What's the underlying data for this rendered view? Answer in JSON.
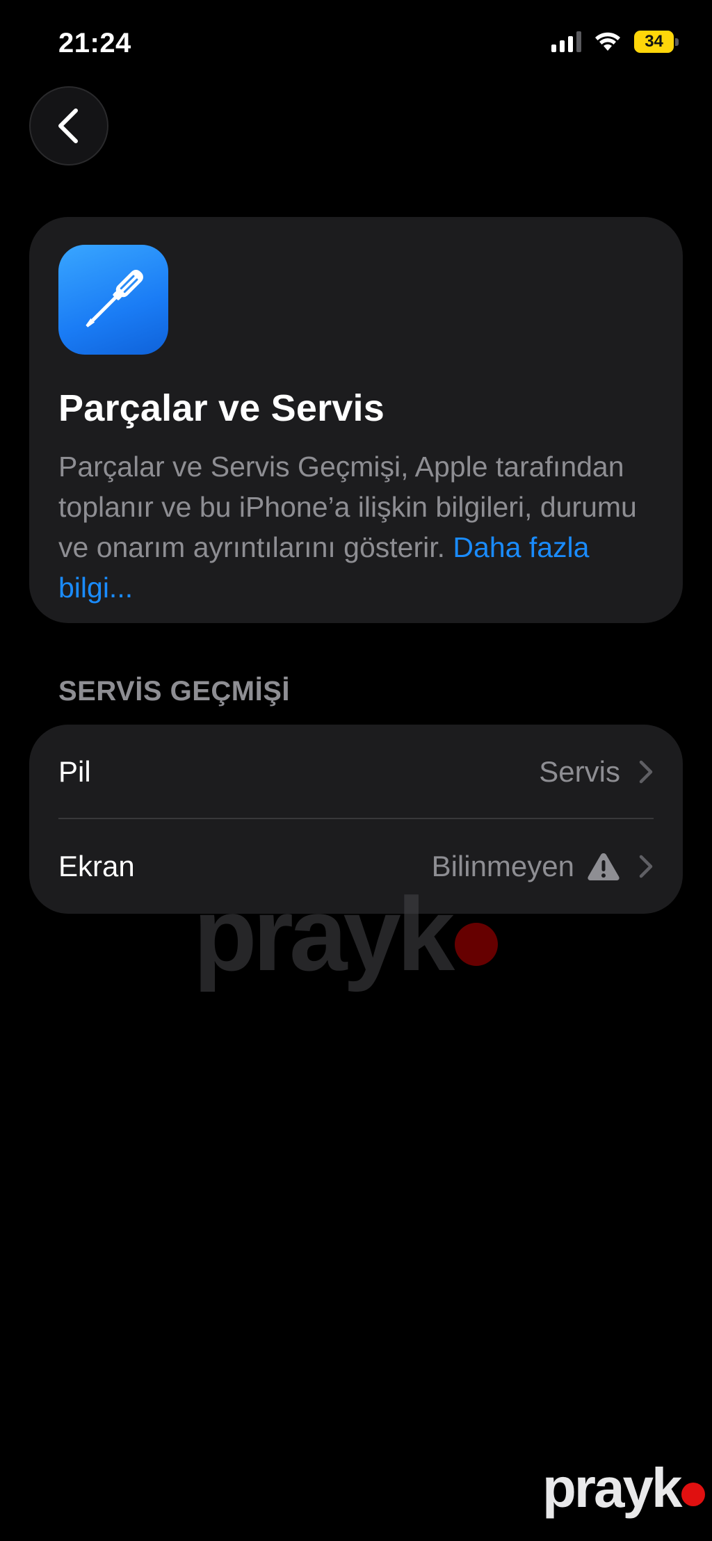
{
  "status_bar": {
    "time": "21:24",
    "battery_percent": "34",
    "battery_level": 0.34,
    "signal_bars_active": 3,
    "battery_color": "#ffd60a"
  },
  "back_button": {
    "icon": "chevron-left-icon"
  },
  "info_card": {
    "app_icon": "screwdriver-icon",
    "title": "Parçalar ve Servis",
    "description": "Parçalar ve Servis Geçmişi, Apple tarafından toplanır ve bu iPhone’a ilişkin bilgileri, durumu ve onarım ayrıntılarını gösterir.",
    "link": "Daha fazla bilgi..."
  },
  "service_history": {
    "header": "SERVİS GEÇMİŞİ",
    "rows": [
      {
        "label": "Pil",
        "value": "Servis"
      },
      {
        "label": "Ekran",
        "value": "Bilinmeyen",
        "status_icon": "warning-icon"
      }
    ]
  },
  "watermarks": {
    "center": "prayk",
    "corner": "prayk"
  },
  "colors": {
    "background": "#000000",
    "card": "#1c1c1e",
    "secondary_text": "#8e8e93",
    "link": "#1a8cff",
    "icon_gradient_top": "#39a6ff",
    "icon_gradient_bottom": "#0f62d9"
  }
}
